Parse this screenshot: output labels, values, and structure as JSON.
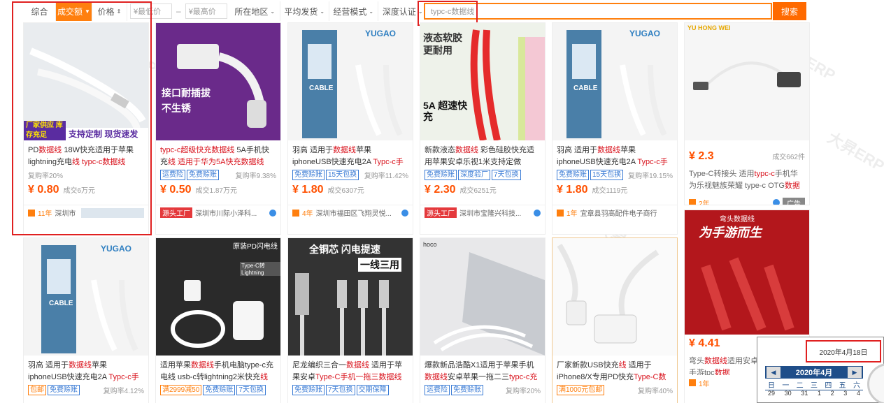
{
  "filters": {
    "comprehensive": "综合",
    "volume": "成交额",
    "price": "价格",
    "min_price": "¥最低价",
    "dash": "–",
    "max_price": "¥最高价",
    "region": "所在地区",
    "shipping": "平均发货",
    "business": "经营模式",
    "certification": "深度认证"
  },
  "search": {
    "value": "typc-c数据线",
    "button": "搜索"
  },
  "watermark": "大昇ERP",
  "products": [
    {
      "img_label_1": "厂家供应 库存充足",
      "img_label_2": "支持定制 现货速发",
      "title_pre": "PD",
      "title_hl": "数据线",
      "title_post": " 18W快充适用于苹果lightning充电",
      "title_hl2": "线 typc-c数据线",
      "tags": [],
      "rep": "复购率20%",
      "price": "¥ 0.80",
      "deal": "成交6万元",
      "years": "11年",
      "shop": "深圳市"
    },
    {
      "img_label_1": "接口耐插拔",
      "img_label_2": "不生锈",
      "title_pre": "typc-c超级快充",
      "title_hl": "数据线",
      "title_post": " 5A手机快充",
      "title_hl2": "线 适用于华为5A快充数据线",
      "tags": [
        "运费险",
        "免费赊账"
      ],
      "rep": "复购率9.38%",
      "price": "¥ 0.50",
      "deal": "成交1.87万元",
      "source": "源头工厂",
      "shop": "深圳市川际小泽科..."
    },
    {
      "img_label_1": "CABLE",
      "img_label_2": "YUGAO",
      "title_pre": "羽高 适用于",
      "title_hl": "数据线",
      "title_post": "苹果iphoneUSB快速充电2A ",
      "title_hl2": "Typc-c手机线快充批",
      "tags": [
        "免费赊账",
        "15天包换"
      ],
      "rep": "复购率11.42%",
      "price": "¥ 1.80",
      "deal": "成交6307元",
      "years": "4年",
      "shop": "深圳市福田区飞翔灵悦..."
    },
    {
      "img_label_1": "液态软胶 更耐用",
      "img_label_2": "5A 超速快充",
      "title_pre": "新款液态",
      "title_hl": "数据线",
      "title_post": " 彩色硅胶快充适用苹果安卓乐视1米支持定做",
      "title_hl2": "",
      "tags": [
        "免费赊账",
        "深度验厂",
        "7天包换"
      ],
      "rep": "",
      "price": "¥ 2.30",
      "deal": "成交6251元",
      "source": "源头工厂",
      "shop": "深圳市宝隆兴科技..."
    },
    {
      "img_label_1": "CABLE",
      "img_label_2": "YUGAO",
      "title_pre": "羽高 适用于",
      "title_hl": "数据线",
      "title_post": "苹果iphoneUSB快速充电2A ",
      "title_hl2": "Typc-c手机线快充批",
      "tags": [
        "免费赊账",
        "15天包换"
      ],
      "rep": "复购率19.15%",
      "price": "¥ 1.80",
      "deal": "成交1119元",
      "years": "1年",
      "shop": "宜章县羽高配件电子商行"
    },
    {
      "img_label_1": "YU HONG WEI",
      "img_label_2": "",
      "title_pre": "Type-C转接头 适用",
      "title_hl": "typc-c",
      "title_post": "手机华为乐视魅族荣耀 type-c OTG",
      "title_hl2": "数据线",
      "tags": [],
      "rep": "",
      "price": "¥ 2.3",
      "deal": "成交662件",
      "years": "2年",
      "shop": "广告"
    }
  ],
  "products_row2": [
    {
      "img_label_1": "CABLE",
      "img_label_2": "YUGAO",
      "title_pre": "羽高 适用于",
      "title_hl": "数据线",
      "title_post": "苹果iphoneUSB快速充电2A ",
      "title_hl2": "Typc-c手机线快充批",
      "tags": [
        "包邮",
        "免费赊账"
      ],
      "rep": "复购率4.12%"
    },
    {
      "img_label_1": "原装PD闪电线",
      "img_label_2": "Type-C转Lightning",
      "title_pre": "适用苹果",
      "title_hl": "数据线",
      "title_post": "手机电脑type-c充电线 usb-c转lightning2米快充",
      "title_hl2": "线",
      "tags": [
        "满2999减50",
        "免费赊账",
        "7天包换"
      ],
      "rep": ""
    },
    {
      "img_label_1": "全铜芯 闪电提速",
      "img_label_2": "一线三用",
      "title_pre": "尼龙编织三合一",
      "title_hl": "数据线",
      "title_post": " 适用于苹果安卓",
      "title_hl2": "Type-C手机一拖三数据线",
      "tags": [
        "免费赊账",
        "7天包换",
        "交期保障"
      ],
      "rep": ""
    },
    {
      "img_label_1": "hoco",
      "img_label_2": "",
      "title_pre": "爆款新品浩酷X1适用于苹果手机",
      "title_hl": "数据线",
      "title_post": "安卓苹果一拖二三",
      "title_hl2": "typc-c充电线",
      "tags": [
        "运费险",
        "免费赊账"
      ],
      "rep": "复购率20%"
    },
    {
      "img_label_1": "",
      "img_label_2": "",
      "title_pre": "厂家新款USB快充",
      "title_hl": "线",
      "title_post": " 适用于iPhone8/X专用PD快充",
      "title_hl2": "Type-C数据线批发",
      "tags": [
        "满1000元包邮"
      ],
      "rep": "复购率40%"
    },
    {
      "img_label_1": "弯头数据线",
      "img_label_2": "为手游而生",
      "title_pre": "弯头",
      "title_hl": "数据线",
      "title_post": "适用安卓苹果布艺编织手游tpc",
      "title_hl2": "数据",
      "tags": [],
      "rep": "",
      "price": "¥ 4.41",
      "years": "1年"
    }
  ],
  "calendar": {
    "date_text": "2020年4月18日",
    "month_title": "2020年4月",
    "prev": "◀",
    "next": "▶",
    "weekdays": [
      "日",
      "一",
      "二",
      "三",
      "四",
      "五",
      "六"
    ],
    "days_row1": [
      "29",
      "30",
      "31",
      "1",
      "2",
      "3",
      "4"
    ]
  },
  "colors": {
    "accent": "#ff7f0e",
    "price": "#ff5000",
    "highlight": "#d9141e",
    "annotation": "#e02020"
  }
}
